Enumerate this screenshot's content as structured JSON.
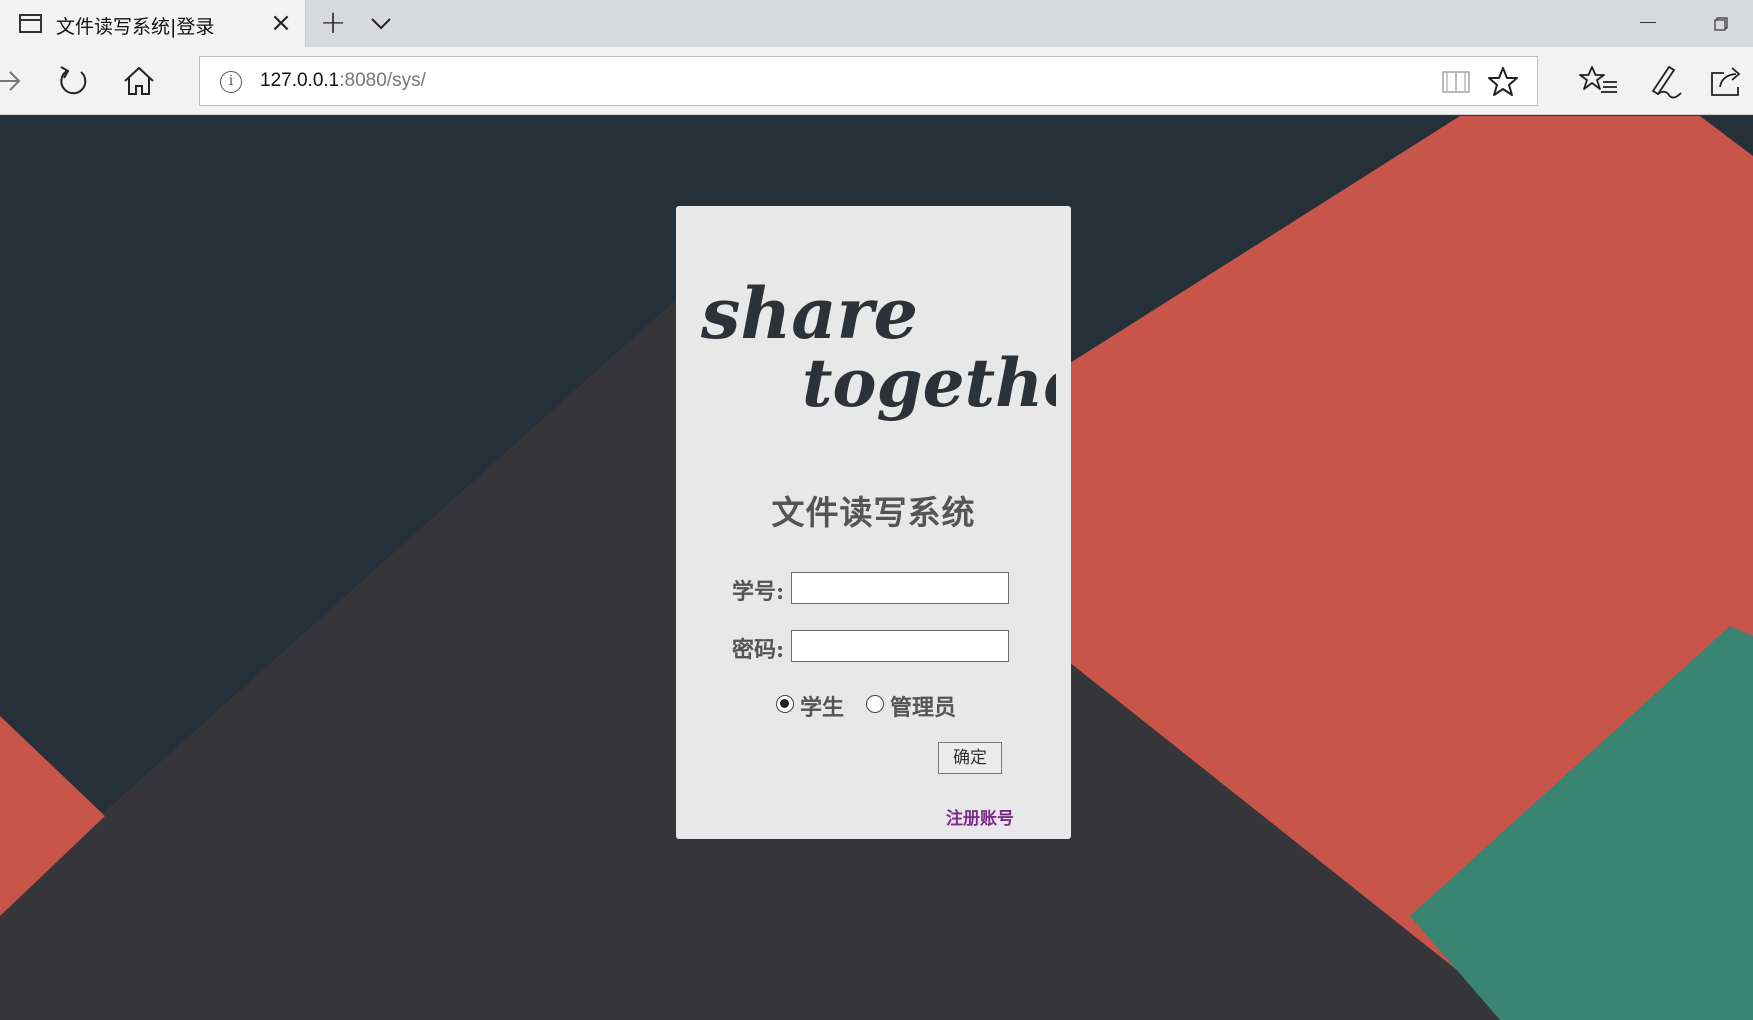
{
  "browser": {
    "tab_title": "文件读写系统|登录",
    "url_host": "127.0.0.1",
    "url_rest": ":8080/sys/"
  },
  "page": {
    "logo_text": [
      "share",
      "together"
    ],
    "system_title": "文件读写系统",
    "student_id_label": "学号:",
    "student_id_value": "",
    "password_label": "密码:",
    "password_value": "",
    "roles": [
      {
        "label": "学生",
        "checked": true
      },
      {
        "label": "管理员",
        "checked": false
      }
    ],
    "submit_label": "确定",
    "register_link": "注册账号"
  },
  "colors": {
    "dark_bg": "#35353a",
    "dark_slate": "#263038",
    "coral": "#c8554a",
    "teal": "#3a8472",
    "card_bg": "#e8e8e9",
    "link_purple": "#7a2b8a"
  }
}
